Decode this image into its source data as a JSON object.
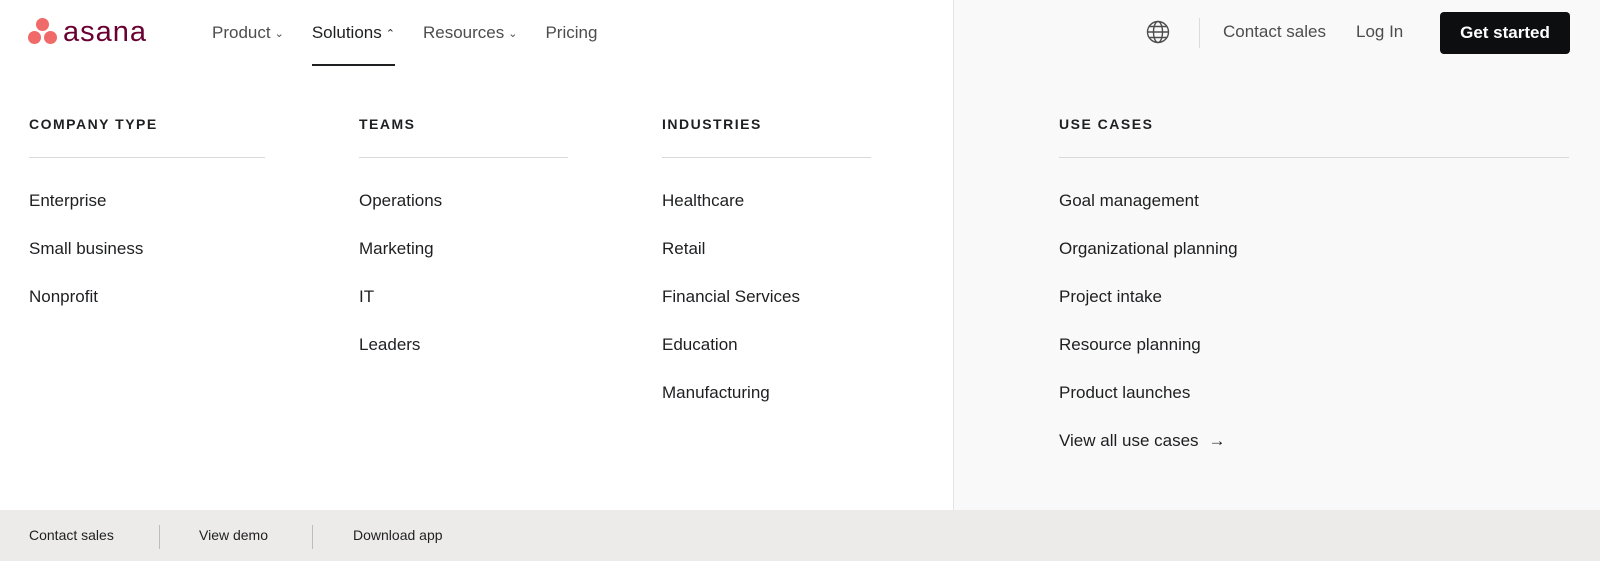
{
  "brand": {
    "name": "asana",
    "dot_color": "#f06a6a",
    "word_color": "#690031"
  },
  "nav": [
    {
      "label": "Product",
      "chevron": "chevron-down"
    },
    {
      "label": "Solutions",
      "chevron": "chevron-up",
      "active": true
    },
    {
      "label": "Resources",
      "chevron": "chevron-down"
    },
    {
      "label": "Pricing"
    }
  ],
  "header": {
    "globe_icon": "globe-icon",
    "contact_sales": "Contact sales",
    "log_in": "Log In",
    "get_started": "Get started"
  },
  "menu": {
    "company_type": {
      "title": "COMPANY TYPE",
      "items": [
        "Enterprise",
        "Small business",
        "Nonprofit"
      ]
    },
    "teams": {
      "title": "TEAMS",
      "items": [
        "Operations",
        "Marketing",
        "IT",
        "Leaders"
      ]
    },
    "industries": {
      "title": "INDUSTRIES",
      "items": [
        "Healthcare",
        "Retail",
        "Financial Services",
        "Education",
        "Manufacturing"
      ]
    },
    "use_cases": {
      "title": "USE CASES",
      "items": [
        "Goal management",
        "Organizational planning",
        "Project intake",
        "Resource planning",
        "Product launches"
      ],
      "view_all": "View all use cases",
      "view_all_icon": "arrow-right-icon"
    }
  },
  "footer": {
    "contact_sales": "Contact sales",
    "view_demo": "View demo",
    "download_app": "Download app"
  }
}
